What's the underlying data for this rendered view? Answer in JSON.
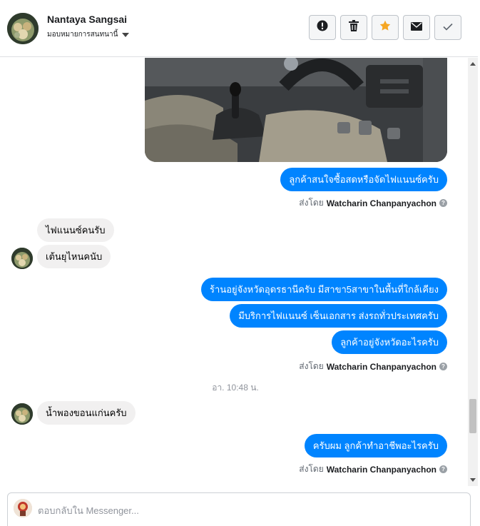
{
  "header": {
    "contact_name": "Nantaya Sangsai",
    "assign_label": "มอบหมายการสนทนานี้",
    "actions": [
      {
        "name": "report-spam-button",
        "icon": "alert-circle-icon"
      },
      {
        "name": "delete-button",
        "icon": "trash-icon"
      },
      {
        "name": "star-button",
        "icon": "star-icon"
      },
      {
        "name": "mark-unread-button",
        "icon": "envelope-icon"
      },
      {
        "name": "mark-done-button",
        "icon": "check-icon"
      }
    ]
  },
  "conversation": {
    "outgoing_1": "ลูกค้าสนใจซื้อสดหรือจัดไฟแนนซ์ครับ",
    "sent_by_1": {
      "prefix": "ส่งโดย",
      "agent": "Watcharin Chanpanyachon"
    },
    "incoming_1": "ไฟแนนซ์คนรับ",
    "incoming_2": "เต้นยุไหนคนับ",
    "outgoing_2": "ร้านอยู่จังหวัดอุดรธานีครับ มีสาขา5สาขาในพื้นที่ใกล้เคียง",
    "outgoing_3": "มีบริการไฟแนนซ์ เซ็นเอกสาร ส่งรถทั่วประเทศครับ",
    "outgoing_4": "ลูกค้าอยู่จังหวัดอะไรครับ",
    "sent_by_2": {
      "prefix": "ส่งโดย",
      "agent": "Watcharin Chanpanyachon"
    },
    "timestamp": "อา. 10:48 น.",
    "incoming_3": "น้ำพองขอนแก่นครับ",
    "outgoing_5": "ครับผม ลูกค้าทำอาชีพอะไรครับ",
    "sent_by_3": {
      "prefix": "ส่งโดย",
      "agent": "Watcharin Chanpanyachon"
    }
  },
  "composer": {
    "placeholder": "ตอบกลับใน Messenger..."
  },
  "colors": {
    "outgoing_bubble": "#0084ff",
    "incoming_bubble": "#f1f0f0",
    "star": "#f5a623"
  }
}
